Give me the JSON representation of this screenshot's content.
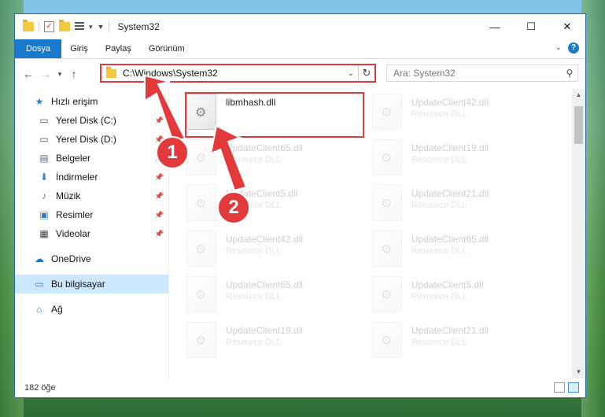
{
  "window": {
    "title": "System32",
    "controls": {
      "minimize": "—",
      "maximize": "☐",
      "close": "✕"
    }
  },
  "ribbon": {
    "tabs": [
      "Dosya",
      "Giriş",
      "Paylaş",
      "Görünüm"
    ],
    "help": "?"
  },
  "address": {
    "path": "C:\\Windows\\System32",
    "search_placeholder": "Ara: System32"
  },
  "sidebar": {
    "items": [
      {
        "label": "Hızlı erişim",
        "icon": "star-icon",
        "pinned": false
      },
      {
        "label": "Yerel Disk (C:)",
        "icon": "drive-icon",
        "pinned": true
      },
      {
        "label": "Yerel Disk (D:)",
        "icon": "drive-icon",
        "pinned": true
      },
      {
        "label": "Belgeler",
        "icon": "documents-icon",
        "pinned": true
      },
      {
        "label": "İndirmeler",
        "icon": "download-icon",
        "pinned": true
      },
      {
        "label": "Müzik",
        "icon": "music-icon",
        "pinned": true
      },
      {
        "label": "Resimler",
        "icon": "pictures-icon",
        "pinned": true
      },
      {
        "label": "Videolar",
        "icon": "video-icon",
        "pinned": true
      },
      {
        "label": "OneDrive",
        "icon": "cloud-icon",
        "pinned": false
      },
      {
        "label": "Bu bilgisayar",
        "icon": "computer-icon",
        "pinned": false,
        "selected": true
      },
      {
        "label": "Ağ",
        "icon": "network-icon",
        "pinned": false
      }
    ]
  },
  "files": [
    {
      "name": "libmhash.dll",
      "type": "",
      "highlighted": true
    },
    {
      "name": "UpdateClient42.dll",
      "type": "Resource DLL"
    },
    {
      "name": "UpdateClient65.dll",
      "type": "Resource DLL"
    },
    {
      "name": "UpdateClient19.dll",
      "type": "Resource DLL"
    },
    {
      "name": "UpdateClient5.dll",
      "type": "Resource DLL"
    },
    {
      "name": "UpdateClient21.dll",
      "type": "Resource DLL"
    },
    {
      "name": "UpdateClient42.dll",
      "type": "Resource DLL"
    },
    {
      "name": "UpdateClient65.dll",
      "type": "Resource DLL"
    },
    {
      "name": "UpdateClient65.dll",
      "type": "Resource DLL"
    },
    {
      "name": "UpdateClient5.dll",
      "type": "Resource DLL"
    },
    {
      "name": "UpdateClient19.dll",
      "type": "Resource DLL"
    },
    {
      "name": "UpdateClient21.dll",
      "type": "Resource DLL"
    }
  ],
  "status": {
    "count": "182 öğe"
  },
  "annotations": {
    "step1": "1",
    "step2": "2",
    "color": "#e23a3a"
  }
}
